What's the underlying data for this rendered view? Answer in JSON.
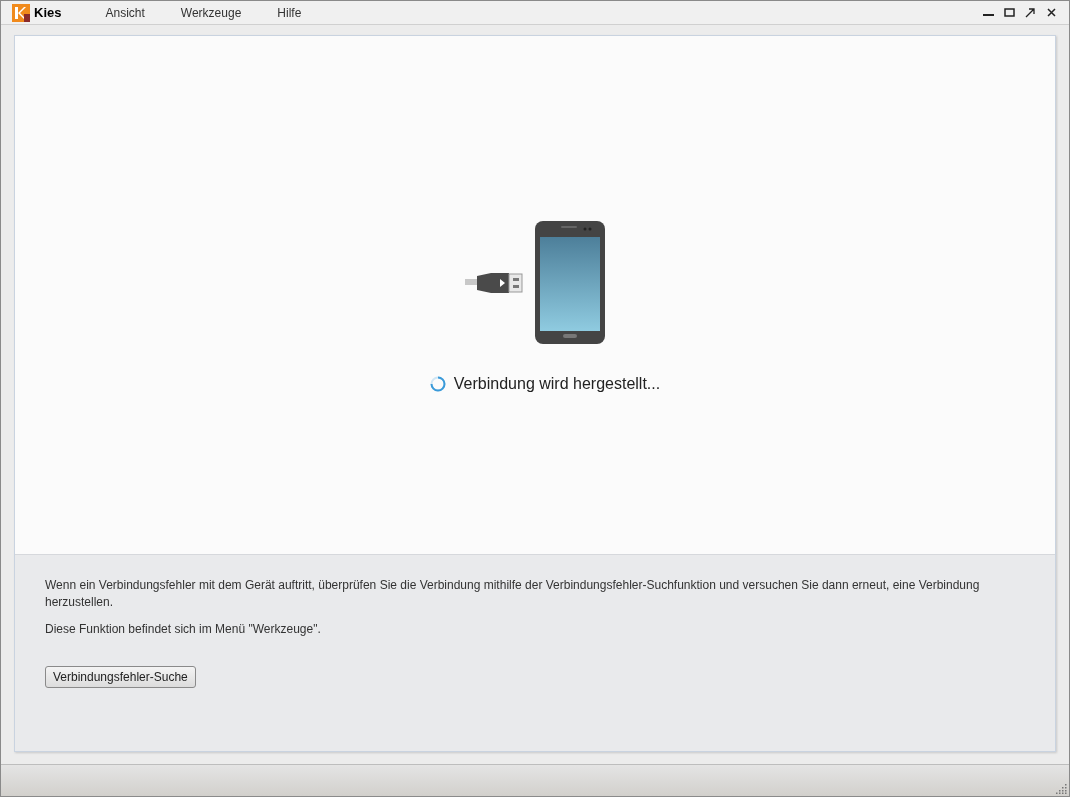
{
  "app": {
    "title": "Kies"
  },
  "menu": [
    {
      "label": "Ansicht"
    },
    {
      "label": "Werkzeuge"
    },
    {
      "label": "Hilfe"
    }
  ],
  "status": {
    "message": "Verbindung wird hergestellt..."
  },
  "help": {
    "paragraphs": [
      "Wenn ein Verbindungsfehler mit dem Gerät auftritt, überprüfen Sie die Verbindung mithilfe der Verbindungsfehler-Suchfunktion und versuchen Sie dann erneut, eine Verbindung herzustellen.",
      "Diese Funktion befindet sich im Menü \"Werkzeuge\"."
    ],
    "button": "Verbindungsfehler-Suche"
  }
}
